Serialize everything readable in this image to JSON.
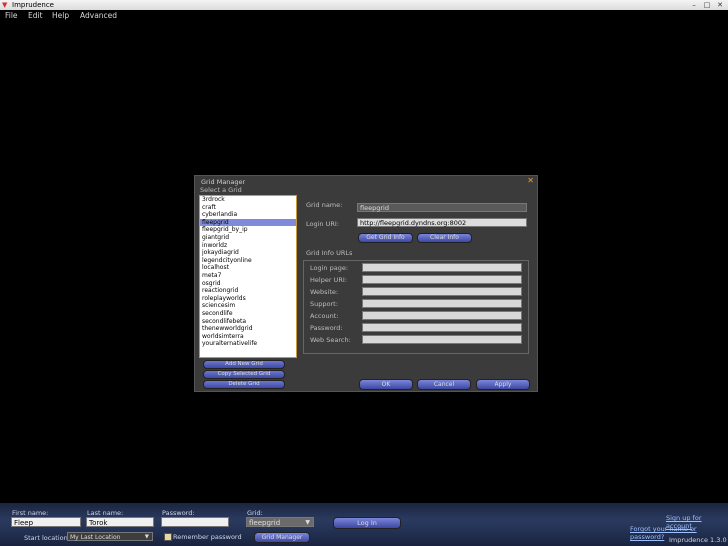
{
  "window": {
    "title": "Imprudence",
    "controls": [
      "–",
      "□",
      "✕"
    ]
  },
  "menu": [
    "File",
    "Edit",
    "Help",
    "Advanced"
  ],
  "dialog": {
    "title": "Grid Manager",
    "close_glyph": "✕",
    "select_label": "Select a Grid",
    "grids": [
      "3rdrock",
      "craft",
      "cyberlandia",
      "fleepgrid",
      "fleepgrid_by_ip",
      "giantgrid",
      "inworldz",
      "jokaydiagrid",
      "legendcityonline",
      "localhost",
      "meta7",
      "osgrid",
      "reactiongrid",
      "roleplayworlds",
      "sciencesim",
      "secondlife",
      "secondlifebeta",
      "thenewworldgrid",
      "worldsimterra",
      "youralternativelife"
    ],
    "selected_grid": "fleepgrid",
    "list_buttons": [
      "Add New Grid",
      "Copy Selected Grid",
      "Delete Grid"
    ],
    "grid_name_label": "Grid name:",
    "grid_name_value": "fleepgrid",
    "login_uri_label": "Login URI:",
    "login_uri_value": "http://fleepgrid.dyndns.org:8002",
    "get_grid_info": "Get Grid Info",
    "clear_info": "Clear Info",
    "info_urls_label": "Grid Info URLs",
    "info_fields": [
      "Login page:",
      "Helper URI:",
      "Website:",
      "Support:",
      "Account:",
      "Password:",
      "Web Search:"
    ],
    "ok": "OK",
    "cancel": "Cancel",
    "apply": "Apply"
  },
  "login": {
    "first_name_label": "First name:",
    "first_name_value": "Fleep",
    "last_name_label": "Last name:",
    "last_name_value": "Torok",
    "password_label": "Password:",
    "password_value": "",
    "grid_label": "Grid:",
    "grid_value": "fleepgrid",
    "login_button": "Log In",
    "start_location_label": "Start location:",
    "start_location_value": "My Last Location",
    "remember_password": "Remember password",
    "grid_manager_button": "Grid Manager",
    "signup_link": "Sign up for account",
    "forgot_link": "Forgot your name or password?",
    "version": "Imprudence 1.3.0"
  }
}
